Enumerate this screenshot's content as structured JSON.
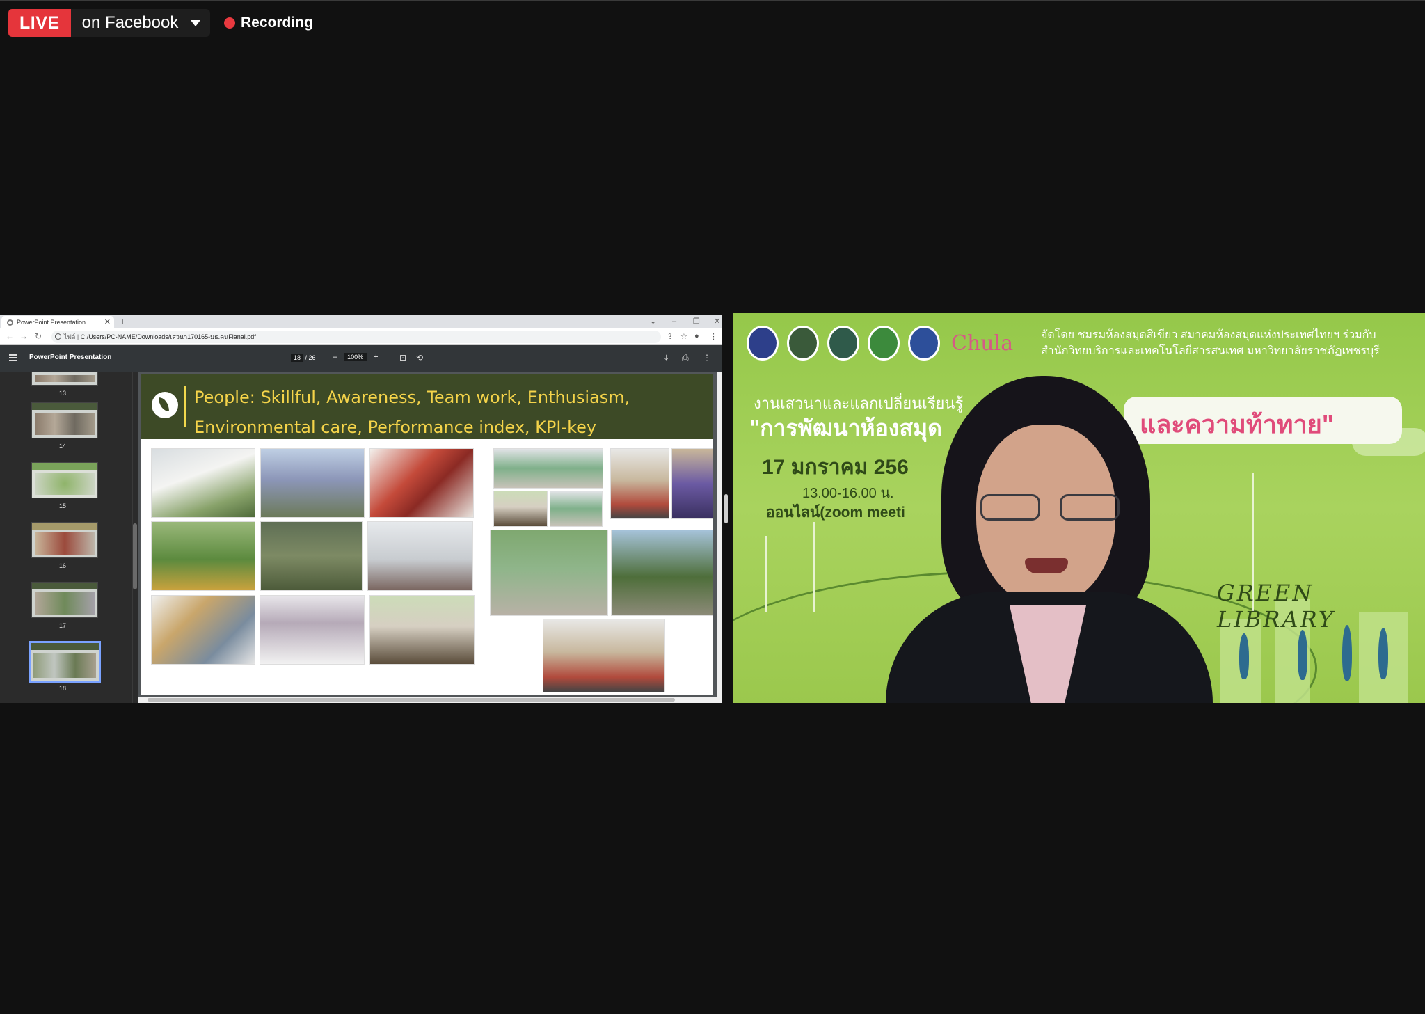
{
  "live": {
    "badge": "LIVE",
    "destination": "on Facebook",
    "recording": "Recording"
  },
  "browser": {
    "tab_title": "PowerPoint Presentation",
    "new_tab": "+",
    "url_prefix": "ไฟล์ |",
    "url": "C:/Users/PC-NAME/Downloads/เสวนา170165-มธ.คนFianal.pdf"
  },
  "pdf": {
    "title": "PowerPoint Presentation",
    "page_current": "18",
    "page_total": "/ 26",
    "zoom": "100%",
    "zoom_out": "–",
    "zoom_in": "+"
  },
  "thumbnails": [
    {
      "num": "13"
    },
    {
      "num": "14"
    },
    {
      "num": "15"
    },
    {
      "num": "16"
    },
    {
      "num": "17"
    },
    {
      "num": "18"
    }
  ],
  "slide": {
    "title_line1": "People: Skillful, Awareness, Team work, Enthusiasm,",
    "title_line2": "Environmental care, Performance index, KPI-key"
  },
  "banner": {
    "org_line1": "จัดโดย ชมรมห้องสมุดสีเขียว สมาคมห้องสมุดแห่งประเทศไทยฯ ร่วมกับ",
    "org_line2": "สำนักวิทยบริการและเทคโนโลยีสารสนเทศ มหาวิทยาลัยราชภัฏเพชรบุรี",
    "chula": "Chula",
    "event_line1": "งานเสวนาและแลกเปลี่ยนเรียนรู้",
    "event_line2": "\"การพัฒนาห้องสมุด",
    "date": "17 มกราคม 256",
    "time": "13.00-16.00 น.",
    "online": "ออนไลน์(zoom meeti",
    "pill_text": "และความท้าทาย\"",
    "green_library": "GREEN LIBRARY"
  }
}
